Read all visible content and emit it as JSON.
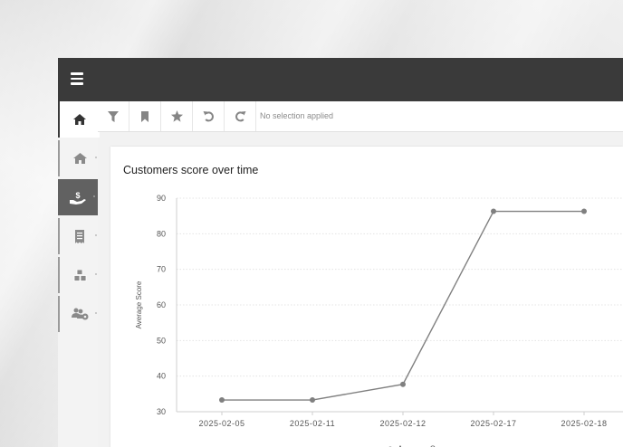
{
  "toolbar": {
    "selection_text": "No selection applied",
    "buttons": [
      "filter-icon",
      "bookmark-icon",
      "star-icon",
      "undo-icon",
      "redo-icon"
    ]
  },
  "sidebar": {
    "items": [
      "home-icon",
      "home-outline-icon",
      "hand-dollar-icon",
      "receipt-icon",
      "boxes-icon",
      "user-settings-icon"
    ]
  },
  "colors": {
    "topbar": "#3a3a3a",
    "active_nav": "#616161",
    "series": "#808080"
  },
  "chart_data": {
    "type": "line",
    "title": "Customers score over time",
    "ylabel": "Average Score",
    "xlabel": "",
    "categories": [
      "2025-02-05",
      "2025-02-11",
      "2025-02-12",
      "2025-02-17",
      "2025-02-18"
    ],
    "series": [
      {
        "name": "Average Score",
        "values": [
          33.3,
          33.3,
          37.7,
          86.3,
          86.3
        ]
      }
    ],
    "ylim": [
      30,
      90
    ],
    "yticks": [
      30,
      40,
      50,
      60,
      70,
      80,
      90
    ],
    "grid": true,
    "legend": "bottom"
  }
}
